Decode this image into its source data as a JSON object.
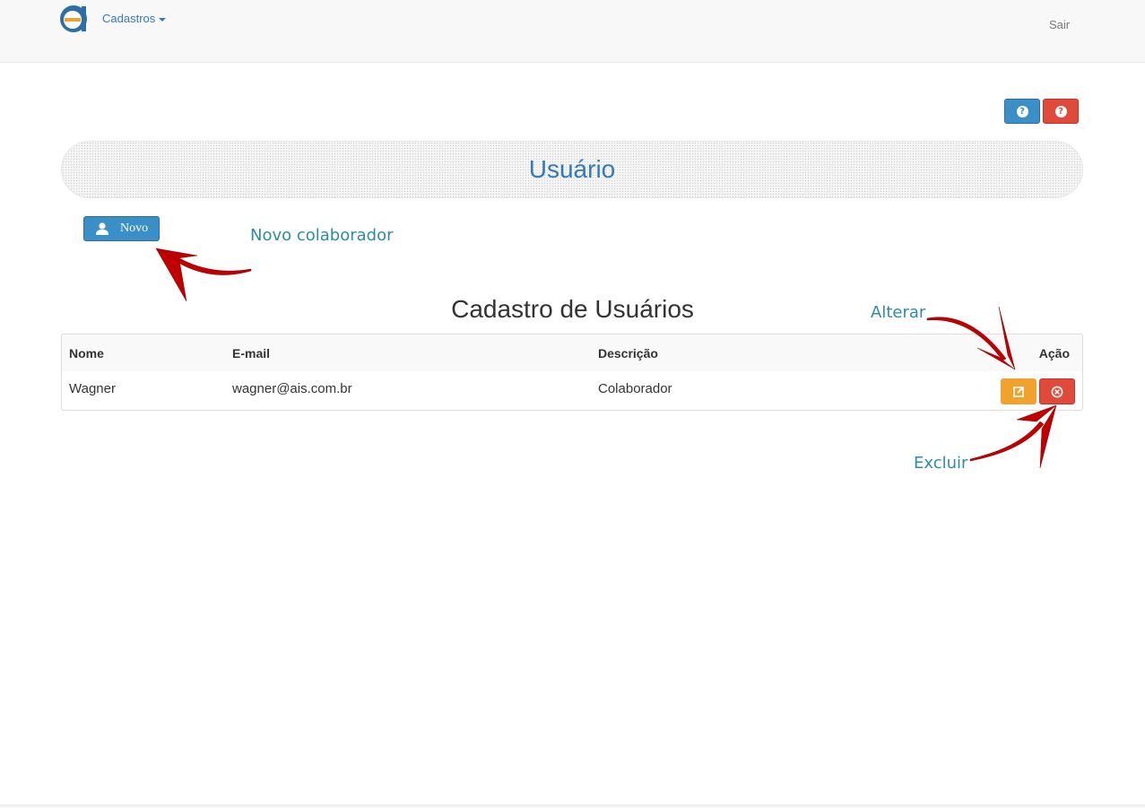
{
  "navbar": {
    "menu_label": "Cadastros",
    "logout_label": "Sair"
  },
  "colors": {
    "primary": "#337ab7",
    "danger": "#e04a3b",
    "warning": "#f0a22c",
    "annotation": "#2e8ba8",
    "arrow": "#c00000"
  },
  "page": {
    "title": "Usuário",
    "new_button_label": "Novo",
    "section_title": "Cadastro de Usuários"
  },
  "annotations": {
    "novo": "Novo colaborador",
    "alterar": "Alterar",
    "excluir": "Excluir"
  },
  "table": {
    "headers": [
      "Nome",
      "E-mail",
      "Descrição",
      "Ação"
    ],
    "rows": [
      {
        "nome": "Wagner",
        "email": "wagner@ais.com.br",
        "descricao": "Colaborador"
      }
    ]
  },
  "icons": {
    "help_blue": "question-circle-icon",
    "help_red": "question-circle-icon",
    "novo": "user-icon",
    "alterar": "edit-icon",
    "excluir": "remove-circle-icon"
  }
}
